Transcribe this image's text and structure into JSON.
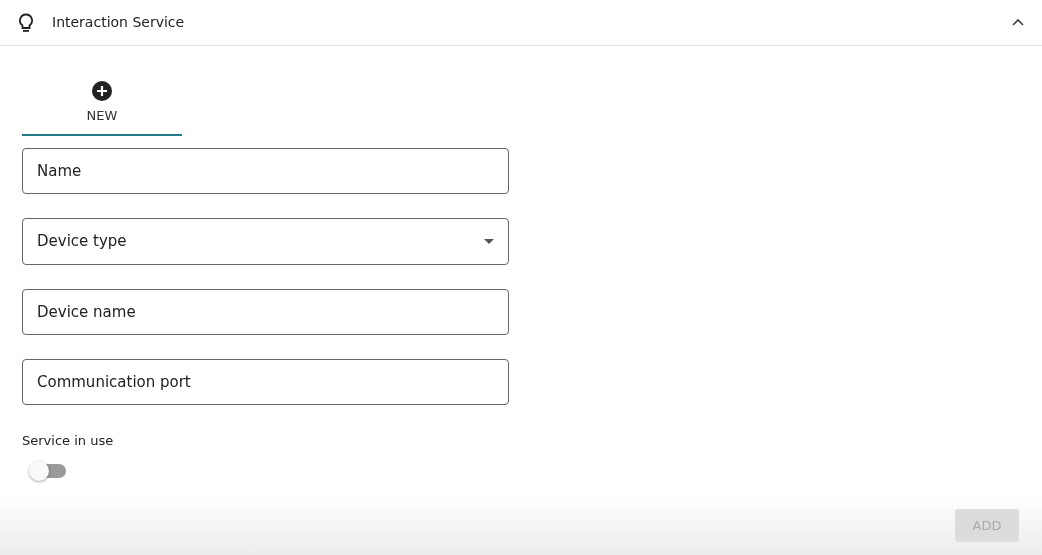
{
  "header": {
    "title": "Interaction Service",
    "expanded": true
  },
  "tabs": [
    {
      "label": "NEW",
      "selected": true
    }
  ],
  "fields": [
    {
      "kind": "text",
      "placeholder": "Name"
    },
    {
      "kind": "select",
      "placeholder": "Device type"
    },
    {
      "kind": "text",
      "placeholder": "Device name"
    },
    {
      "kind": "text",
      "placeholder": "Communication port"
    }
  ],
  "service_toggle": {
    "label": "Service in use",
    "on": false
  },
  "add_button": {
    "label": "ADD",
    "disabled": true
  }
}
